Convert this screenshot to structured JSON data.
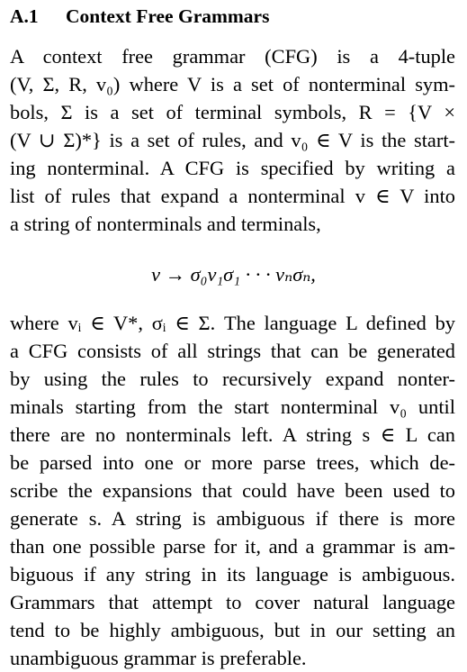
{
  "section": {
    "number": "A.1",
    "title": "Context Free Grammars"
  },
  "paragraph1": {
    "lines": [
      "A context free grammar (CFG) is a 4-tuple",
      "(V, Σ, R, v₀) where V is a set of nonterminal sym-",
      "bols, Σ is a set of terminal symbols, R = {V ×",
      "(V ∪ Σ)*} is a set of rules, and v₀ ∈ V is the start-",
      "ing nonterminal. A CFG is specified by writing a",
      "list of rules that expand a nonterminal v ∈ V into",
      "a string of nonterminals and terminals,"
    ]
  },
  "equation": "v → σ₀v₁σ₁ · · · vₙσₙ,",
  "paragraph2": {
    "lines": [
      "where vᵢ ∈ V*, σᵢ ∈ Σ. The language L defined by",
      "a CFG consists of all strings that can be generated",
      "by using the rules to recursively expand nonter-",
      "minals starting from the start nonterminal v₀ until",
      "there are no nonterminals left. A string s ∈ L can",
      "be parsed into one or more parse trees, which de-",
      "scribe the expansions that could have been used to",
      "generate s. A string is ambiguous if there is more",
      "than one possible parse for it, and a grammar is am-",
      "biguous if any string in its language is ambiguous.",
      "Grammars that attempt to cover natural language",
      "tend to be highly ambiguous, but in our setting an",
      "unambiguous grammar is preferable."
    ]
  }
}
